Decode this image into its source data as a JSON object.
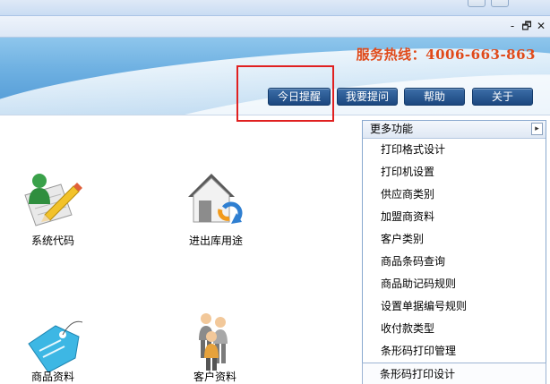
{
  "header": {
    "hotline": "服务热线：4006-663-863",
    "buttons": [
      "今日提醒",
      "我要提问",
      "帮助",
      "关于"
    ]
  },
  "window_controls": {
    "minimize": "-",
    "restore": "🗗",
    "close": "✕"
  },
  "main": {
    "items": [
      {
        "label": "系统代码",
        "icon": "system-code-icon"
      },
      {
        "label": "进出库用途",
        "icon": "warehouse-house-icon"
      },
      {
        "label": "商品资料",
        "icon": "product-tag-icon"
      },
      {
        "label": "客户资料",
        "icon": "customers-icon"
      }
    ]
  },
  "more_menu": {
    "title": "更多功能",
    "expand_symbol": "▸",
    "items": [
      "打印格式设计",
      "打印机设置",
      "供应商类别",
      "加盟商资料",
      "客户类别",
      "商品条码查询",
      "商品助记码规则",
      "设置单据编号规则",
      "收付款类型",
      "条形码打印管理",
      "条形码打印设计"
    ]
  },
  "highlight": {
    "color": "#e02020",
    "target": "今日提醒"
  },
  "colors": {
    "hotline": "#e04a1a",
    "button_bg": "#1b477f"
  }
}
